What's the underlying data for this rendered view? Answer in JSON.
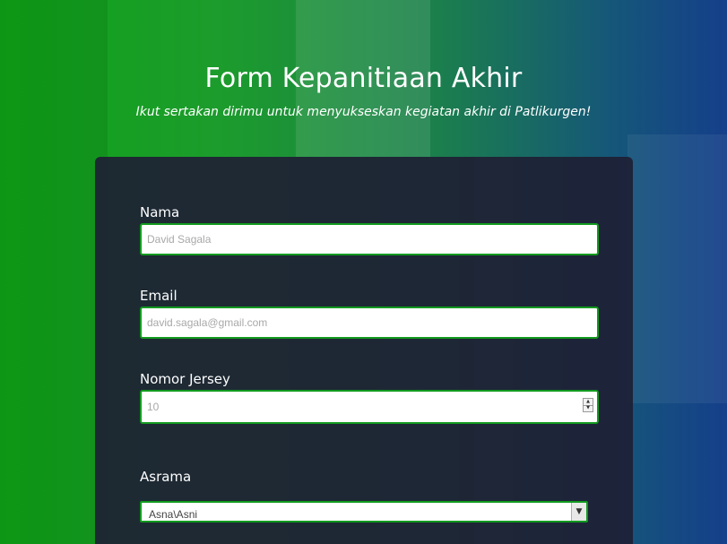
{
  "header": {
    "title": "Form Kepanitiaan Akhir",
    "subtitle": "Ikut sertakan dirimu untuk menyukseskan kegiatan akhir di Patlikurgen!"
  },
  "form": {
    "nama": {
      "label": "Nama",
      "placeholder": "David Sagala"
    },
    "email": {
      "label": "Email",
      "placeholder": "david.sagala@gmail.com"
    },
    "jersey": {
      "label": "Nomor Jersey",
      "placeholder": "10"
    },
    "asrama": {
      "label": "Asrama",
      "selected": "Asna\\Asni"
    }
  },
  "colors": {
    "accent_border": "#129a1f",
    "card_background": "#1e2034"
  }
}
